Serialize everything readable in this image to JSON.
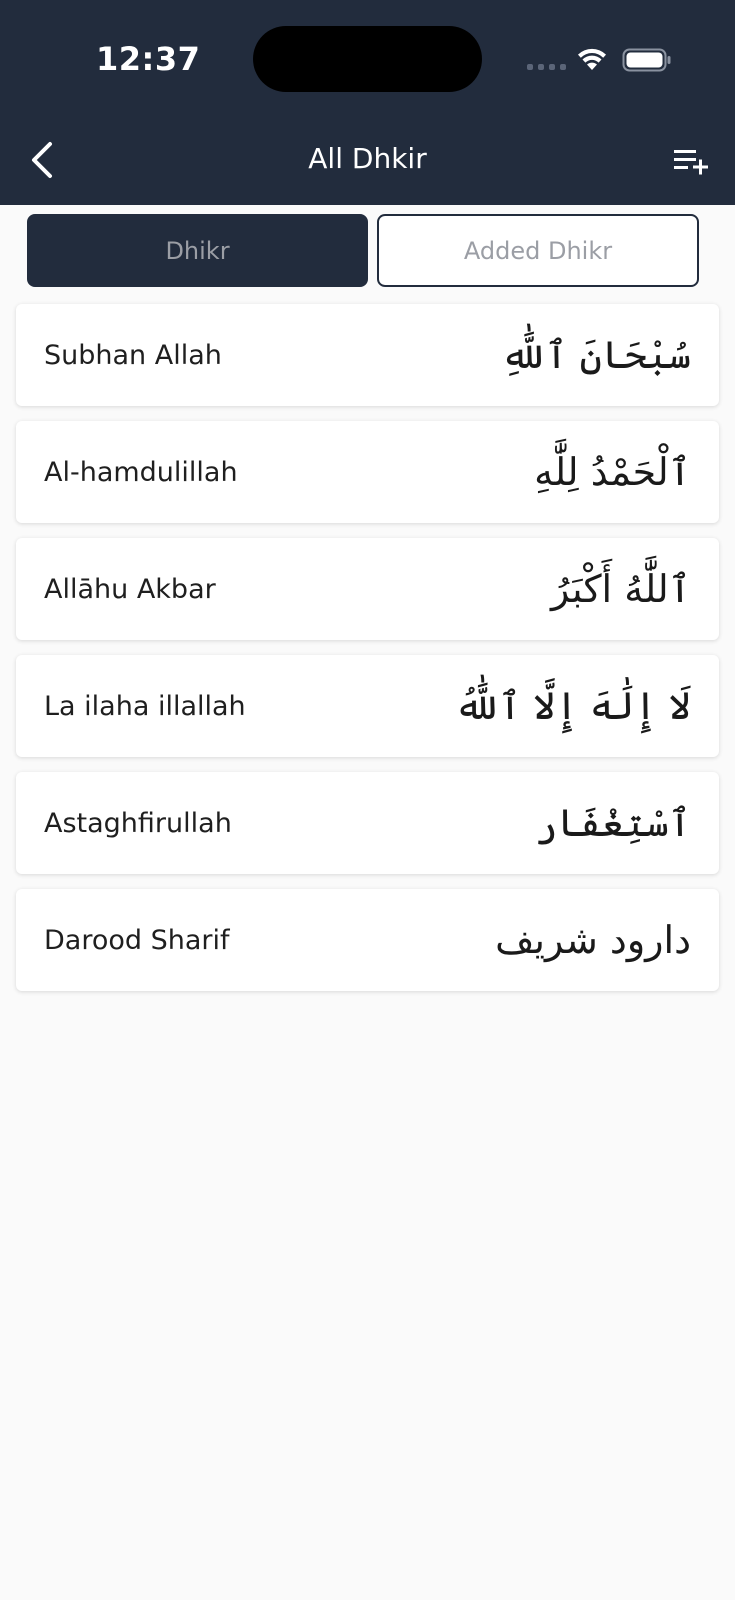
{
  "status_bar": {
    "time": "12:37"
  },
  "header": {
    "title": "All Dhkir",
    "back_icon": "chevron-left-icon",
    "action_icon": "playlist-add-icon"
  },
  "tabs": [
    {
      "label": "Dhikr",
      "selected": true
    },
    {
      "label": "Added Dhikr",
      "selected": false
    }
  ],
  "dhikr_list": [
    {
      "name": "Subhan Allah",
      "arabic": "سُبْحَانَ ٱللَّٰهِ"
    },
    {
      "name": "Al-hamdulillah",
      "arabic": "ٱلْحَمْدُ لِلَّٰهِ"
    },
    {
      "name": "Allāhu Akbar",
      "arabic": "ٱللَّٰهُ أَكْبَرُ"
    },
    {
      "name": "La ilaha illallah",
      "arabic": "لَا إِلَٰهَ إِلَّا ٱللَّٰهُ"
    },
    {
      "name": "Astaghfirullah",
      "arabic": "ٱسْتِغْفَار"
    },
    {
      "name": "Darood Sharif",
      "arabic": "دارود شریف"
    }
  ],
  "colors": {
    "header_bg": "#222c3d",
    "page_bg": "#fafafa",
    "card_bg": "#ffffff",
    "tab_inactive_text": "#9b9ea5"
  }
}
